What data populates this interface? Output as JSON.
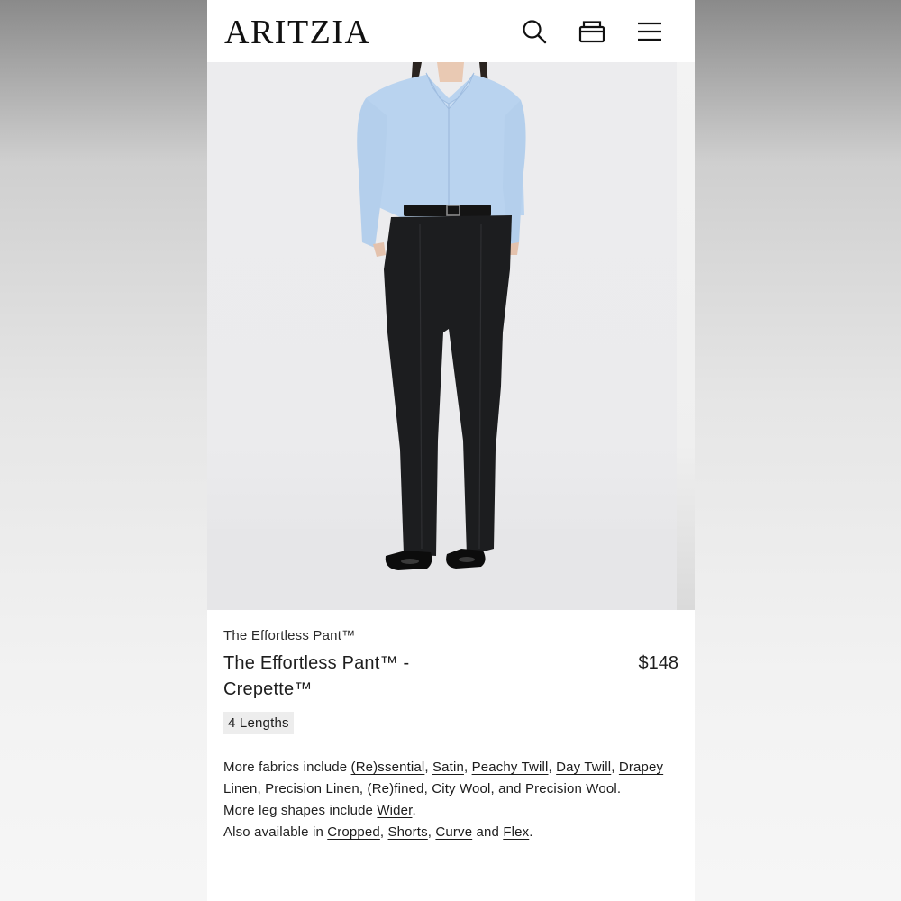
{
  "header": {
    "logo": "ARITZIA",
    "icons": [
      "search-icon",
      "bag-icon",
      "menu-icon"
    ]
  },
  "hero": {
    "image": "model-wearing-black-wide-leg-pant-and-light-blue-shirt"
  },
  "product": {
    "collection": "The Effortless Pant™",
    "title": "The Effortless Pant™ - Crepette™",
    "price": "$148",
    "chip": "4 Lengths"
  },
  "fabrics": {
    "intro": "More fabrics include ",
    "links": [
      "(Re)ssential",
      "Satin",
      "Peachy Twill",
      "Day Twill",
      "Drapey Linen",
      "Precision Linen",
      "(Re)fined",
      "City Wool",
      "Precision Wool"
    ],
    "sep": ", ",
    "and": ", and ",
    "end": "."
  },
  "legshapes": {
    "intro": "More leg shapes include ",
    "link": "Wider",
    "end": "."
  },
  "available": {
    "intro": "Also available in ",
    "links": [
      "Cropped",
      "Shorts",
      "Curve",
      "Flex"
    ],
    "sep": ", ",
    "and": " and ",
    "end": "."
  },
  "colors": {
    "shirt": "#b9d3ef",
    "pant": "#1c1d1f",
    "background": "#ececee"
  }
}
